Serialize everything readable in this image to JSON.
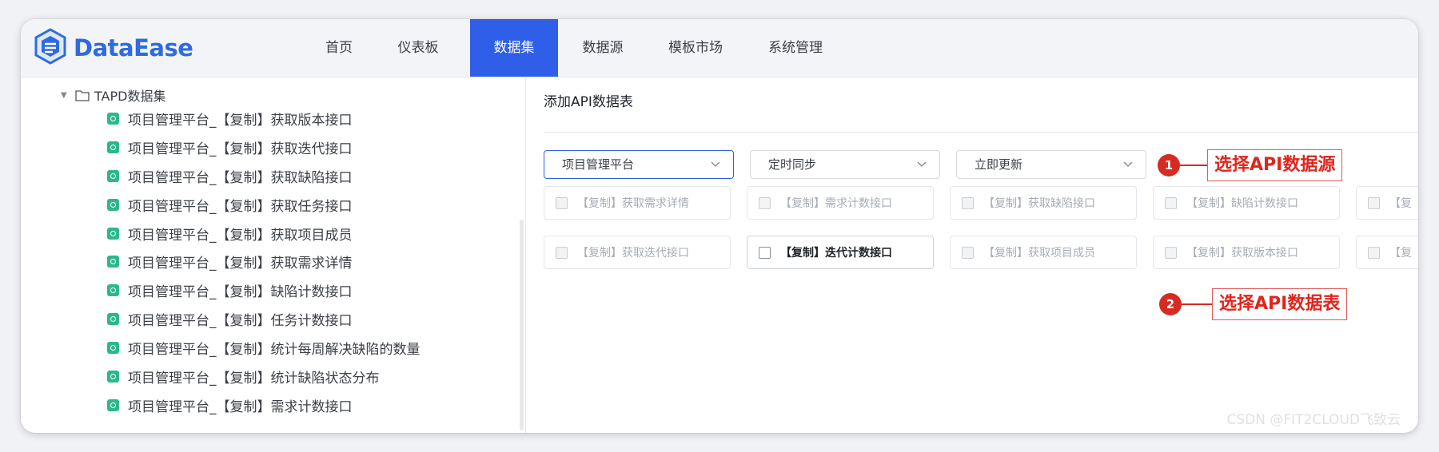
{
  "app": {
    "logo_text": "DataEase",
    "brand_color": "#2f5ee8"
  },
  "nav": {
    "items": [
      {
        "label": "首页",
        "active": false
      },
      {
        "label": "仪表板",
        "active": false
      },
      {
        "label": "数据集",
        "active": true
      },
      {
        "label": "数据源",
        "active": false
      },
      {
        "label": "模板市场",
        "active": false
      },
      {
        "label": "系统管理",
        "active": false
      }
    ]
  },
  "sidebar": {
    "folder": {
      "label": "TAPD数据集",
      "expanded": true
    },
    "items": [
      "项目管理平台_【复制】获取版本接口",
      "项目管理平台_【复制】获取迭代接口",
      "项目管理平台_【复制】获取缺陷接口",
      "项目管理平台_【复制】获取任务接口",
      "项目管理平台_【复制】获取项目成员",
      "项目管理平台_【复制】获取需求详情",
      "项目管理平台_【复制】缺陷计数接口",
      "项目管理平台_【复制】任务计数接口",
      "项目管理平台_【复制】统计每周解决缺陷的数量",
      "项目管理平台_【复制】统计缺陷状态分布",
      "项目管理平台_【复制】需求计数接口"
    ]
  },
  "main": {
    "title": "添加API数据表",
    "selects": {
      "datasource": "项目管理平台",
      "sync_mode": "定时同步",
      "update_mode": "立即更新"
    },
    "tables_row1": [
      {
        "label": "【复制】获取需求详情",
        "enabled": false
      },
      {
        "label": "【复制】需求计数接口",
        "enabled": false
      },
      {
        "label": "【复制】获取缺陷接口",
        "enabled": false
      },
      {
        "label": "【复制】缺陷计数接口",
        "enabled": false
      },
      {
        "label": "【复",
        "enabled": false
      }
    ],
    "tables_row2": [
      {
        "label": "【复制】获取迭代接口",
        "enabled": false
      },
      {
        "label": "【复制】迭代计数接口",
        "enabled": true
      },
      {
        "label": "【复制】获取项目成员",
        "enabled": false
      },
      {
        "label": "【复制】获取版本接口",
        "enabled": false
      },
      {
        "label": "【复",
        "enabled": false
      }
    ]
  },
  "annotations": [
    {
      "number": "1",
      "text": "选择API数据源"
    },
    {
      "number": "2",
      "text": "选择API数据表"
    }
  ],
  "watermark": "CSDN @FIT2CLOUD飞致云"
}
